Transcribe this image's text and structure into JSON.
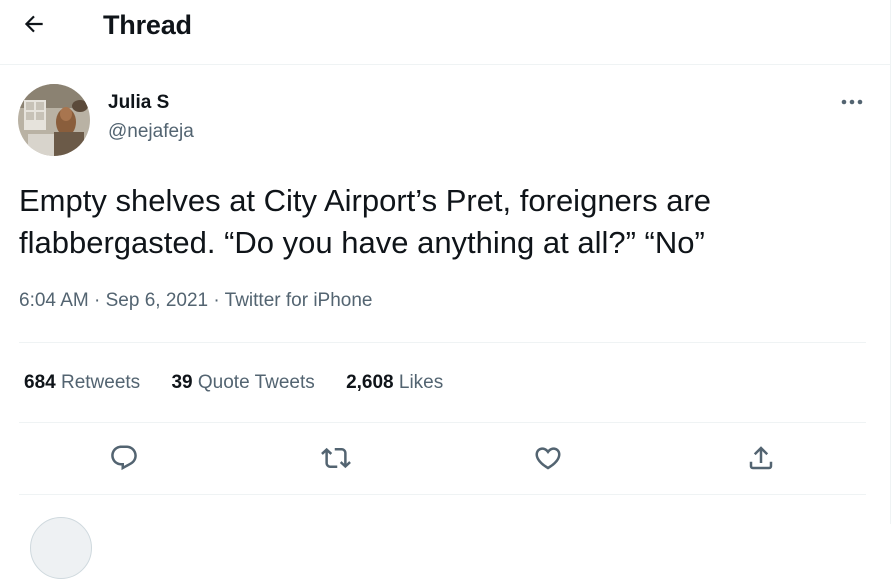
{
  "header": {
    "back_icon": "arrow-left-icon",
    "title": "Thread"
  },
  "tweet": {
    "author": {
      "name": "Julia S",
      "handle": "@nejafeja",
      "avatar_icon": "profile-photo"
    },
    "text_line1": "Empty shelves at City Airport’s Pret, foreigners are",
    "text_line2": "flabbergasted. “Do you have anything at all?” “No”",
    "time": "6:04 AM",
    "date": "Sep 6, 2021",
    "separator": "·",
    "source": "Twitter for iPhone",
    "stats": {
      "retweets_count": "684",
      "retweets_label": "Retweets",
      "quotes_count": "39",
      "quotes_label": "Quote Tweets",
      "likes_count": "2,608",
      "likes_label": "Likes"
    },
    "actions": {
      "reply_icon": "reply-icon",
      "retweet_icon": "retweet-icon",
      "like_icon": "heart-icon",
      "share_icon": "share-icon"
    },
    "more_icon": "more-icon"
  },
  "colors": {
    "text_primary": "#0f1419",
    "text_secondary": "#536471",
    "divider": "#eff3f4"
  }
}
